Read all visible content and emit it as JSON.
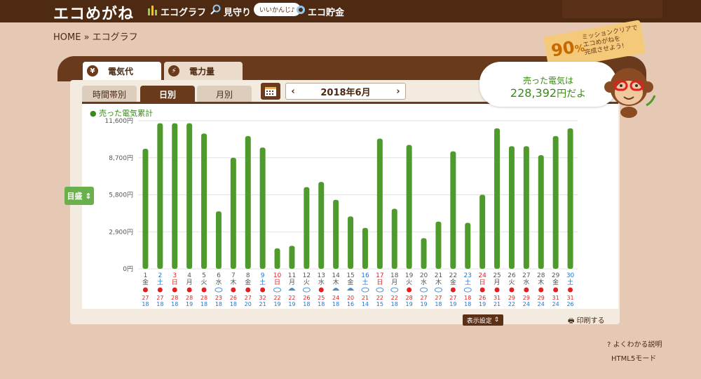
{
  "header": {
    "logo": "エコめがね",
    "nav_graph": "エコグラフ",
    "nav_mimamori": "見守り",
    "bubble": "いいかんじ♪",
    "nav_savings": "エコ貯金"
  },
  "breadcrumb": "HOME » エコグラフ",
  "tabs": {
    "elec_cost": "電気代",
    "elec_amount": "電力量"
  },
  "subtabs": {
    "time": "時間帯別",
    "day": "日別",
    "month": "月別"
  },
  "date": {
    "label": "2018年6月",
    "prev": "‹",
    "next": "›"
  },
  "target_button": "目盛",
  "sold_panel": {
    "line1": "売った電気は",
    "value": "228,392",
    "suffix": "円だよ"
  },
  "mission": {
    "percent": "90",
    "percent_sign": "%",
    "line1": "ミッションクリアで",
    "line2": "エコめがねを",
    "line3": "完成させよう!"
  },
  "buttons": {
    "display_settings": "表示設定",
    "print": "印刷する",
    "help": "よくわかる説明",
    "html5": "HTML5モード"
  },
  "colors": {
    "bar": "#4f9a2c",
    "red": "#e02020",
    "blue": "#1f74d0",
    "gray": "#555555"
  },
  "chart_data": {
    "type": "bar",
    "legend": "売った電気累計",
    "yticks": [
      "0円",
      "2,900円",
      "5,800円",
      "8,700円",
      "11,600円"
    ],
    "ylim": [
      0,
      11600
    ],
    "days": [
      "1",
      "2",
      "3",
      "4",
      "5",
      "6",
      "7",
      "8",
      "9",
      "10",
      "11",
      "12",
      "13",
      "14",
      "15",
      "16",
      "17",
      "18",
      "19",
      "20",
      "21",
      "22",
      "23",
      "24",
      "25",
      "26",
      "27",
      "28",
      "29",
      "30"
    ],
    "weekdays": [
      "金",
      "土",
      "日",
      "月",
      "火",
      "水",
      "木",
      "金",
      "土",
      "日",
      "月",
      "火",
      "水",
      "木",
      "金",
      "土",
      "日",
      "月",
      "火",
      "水",
      "木",
      "金",
      "土",
      "日",
      "月",
      "火",
      "水",
      "木",
      "金",
      "土"
    ],
    "values": [
      9400,
      11400,
      11400,
      11400,
      10600,
      4500,
      8700,
      10400,
      9500,
      1600,
      1800,
      6400,
      6800,
      5400,
      4100,
      3200,
      10200,
      4700,
      9700,
      2400,
      3700,
      9200,
      3600,
      5800,
      11000,
      9600,
      9600,
      8900,
      10400,
      11000
    ],
    "high_temps": [
      "27",
      "27",
      "28",
      "28",
      "28",
      "23",
      "26",
      "27",
      "32",
      "22",
      "22",
      "26",
      "25",
      "24",
      "20",
      "21",
      "22",
      "22",
      "28",
      "27",
      "27",
      "27",
      "18",
      "26",
      "31",
      "29",
      "29",
      "29",
      "31",
      "31"
    ],
    "low_temps": [
      "18",
      "18",
      "18",
      "19",
      "18",
      "18",
      "18",
      "20",
      "21",
      "19",
      "19",
      "18",
      "18",
      "18",
      "16",
      "14",
      "15",
      "18",
      "19",
      "19",
      "18",
      "19",
      "18",
      "19",
      "21",
      "22",
      "24",
      "24",
      "24",
      "26"
    ],
    "weather": [
      "sun",
      "sun",
      "sun",
      "sun",
      "sun",
      "cloud",
      "sun",
      "sun",
      "sun",
      "cloud",
      "rain",
      "cloud",
      "sun",
      "rain",
      "rain",
      "cloud",
      "cloud",
      "cloud",
      "sun",
      "cloud",
      "cloud",
      "sun",
      "cloud",
      "sun",
      "sun",
      "sun",
      "sun",
      "sun",
      "sun",
      "sun"
    ]
  }
}
